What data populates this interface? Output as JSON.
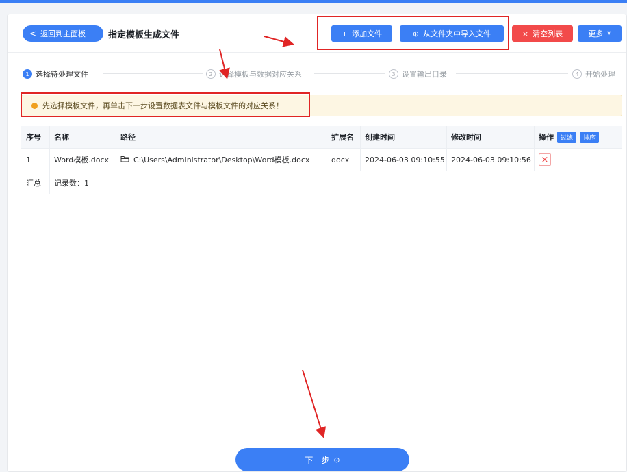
{
  "header": {
    "back_label": "返回到主面板",
    "title": "指定模板生成文件"
  },
  "toolbar": {
    "add_file": "添加文件",
    "import_folder": "从文件夹中导入文件",
    "clear_list": "清空列表",
    "more": "更多"
  },
  "steps": [
    {
      "num": "1",
      "label": "选择待处理文件"
    },
    {
      "num": "2",
      "label": "选择模板与数据对应关系"
    },
    {
      "num": "3",
      "label": "设置输出目录"
    },
    {
      "num": "4",
      "label": "开始处理"
    }
  ],
  "notice": "先选择模板文件，再单击下一步设置数据表文件与模板文件的对应关系！",
  "table": {
    "headers": [
      "序号",
      "名称",
      "路径",
      "扩展名",
      "创建时间",
      "修改时间",
      "操作"
    ],
    "filter_label": "过滤",
    "sort_label": "排序",
    "rows": [
      {
        "index": "1",
        "name": "Word模板.docx",
        "path": "C:\\Users\\Administrator\\Desktop\\Word模板.docx",
        "ext": "docx",
        "created": "2024-06-03 09:10:55",
        "modified": "2024-06-03 09:10:56"
      }
    ],
    "summary_label": "汇总",
    "record_count": "记录数：1"
  },
  "next_label": "下一步",
  "colors": {
    "accent": "#3b7ff5",
    "danger": "#f24a4a",
    "highlight": "#e02525"
  }
}
